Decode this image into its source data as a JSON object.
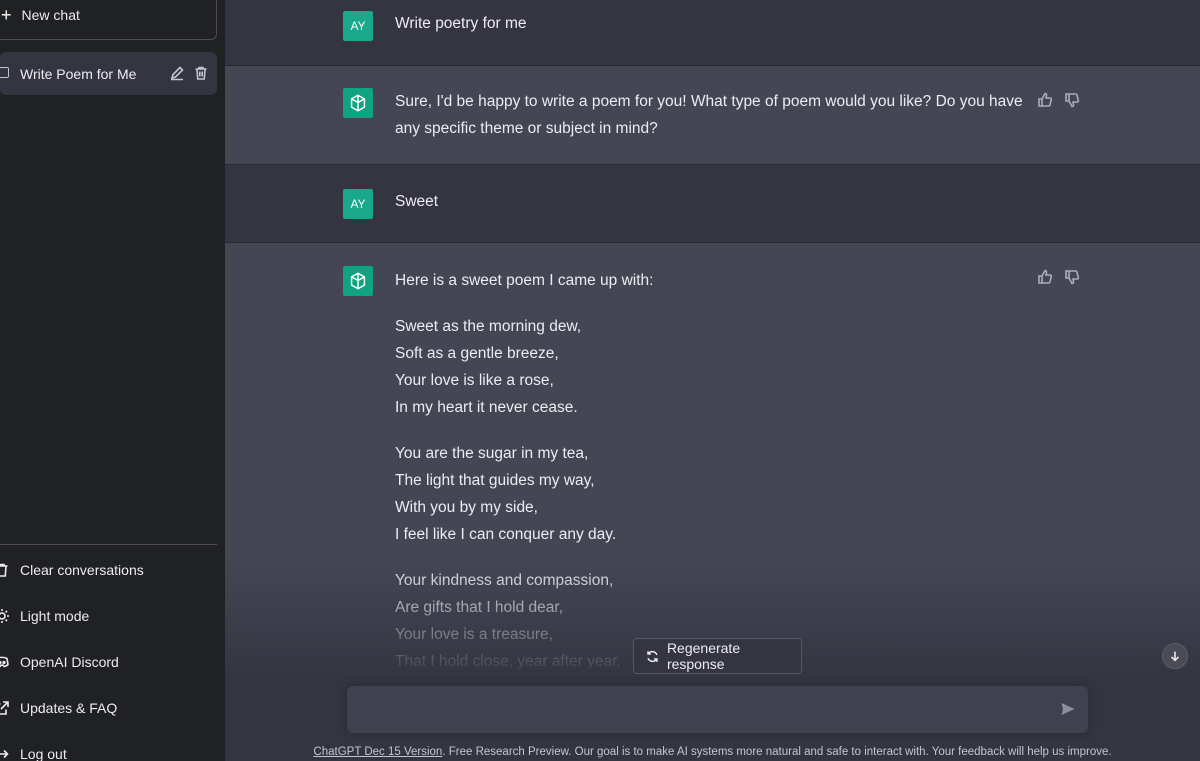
{
  "sidebar": {
    "new_chat": "New chat",
    "conversation": "Write Poem for Me",
    "links": [
      {
        "label": "Clear conversations",
        "icon": "trash-icon"
      },
      {
        "label": "Light mode",
        "icon": "sun-icon"
      },
      {
        "label": "OpenAI Discord",
        "icon": "discord-icon"
      },
      {
        "label": "Updates & FAQ",
        "icon": "external-link-icon"
      },
      {
        "label": "Log out",
        "icon": "logout-icon"
      }
    ]
  },
  "messages": [
    {
      "role": "user",
      "avatar": "AY",
      "text": "Write poetry for me"
    },
    {
      "role": "assistant",
      "text": "Sure, I'd be happy to write a poem for you! What type of poem would you like? Do you have any specific theme or subject in mind?"
    },
    {
      "role": "user",
      "avatar": "AY",
      "text": "Sweet"
    },
    {
      "role": "assistant",
      "intro": "Here is a sweet poem I came up with:",
      "stanzas": [
        [
          "Sweet as the morning dew,",
          "Soft as a gentle breeze,",
          "Your love is like a rose,",
          "In my heart it never cease."
        ],
        [
          "You are the sugar in my tea,",
          "The light that guides my way,",
          "With you by my side,",
          "I feel like I can conquer any day."
        ],
        [
          "Your kindness and compassion,",
          "Are gifts that I hold dear,",
          "Your love is a treasure,",
          "That I hold close, year after year."
        ]
      ]
    }
  ],
  "controls": {
    "regenerate": "Regenerate response",
    "input_placeholder": ""
  },
  "footer": {
    "version_link": "ChatGPT Dec 15 Version",
    "text": ". Free Research Preview. Our goal is to make AI systems more natural and safe to interact with. Your feedback will help us improve."
  },
  "colors": {
    "sidebar_bg": "#202123",
    "main_bg": "#343541",
    "assistant_bg": "#444654",
    "brand_green": "#10a37f"
  }
}
